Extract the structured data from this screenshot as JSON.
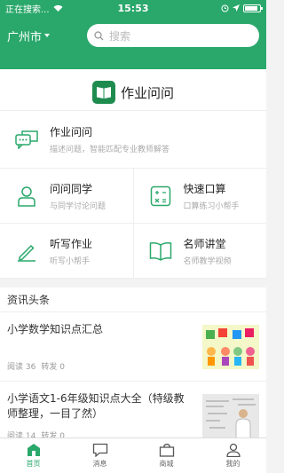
{
  "statusbar": {
    "carrier": "正在搜索...",
    "time": "15:53"
  },
  "nav": {
    "city": "广州市",
    "search_placeholder": "搜索"
  },
  "brand": {
    "title": "作业问问",
    "logo_text": "作业问问"
  },
  "features": {
    "main": {
      "title": "作业问问",
      "subtitle": "描述问题，智能匹配专业教师解答"
    },
    "items": [
      {
        "title": "问问同学",
        "subtitle": "与同学讨论问题"
      },
      {
        "title": "快速口算",
        "subtitle": "口算练习小帮手"
      },
      {
        "title": "听写作业",
        "subtitle": "听写小帮手"
      },
      {
        "title": "名师讲堂",
        "subtitle": "名师教学视频"
      }
    ]
  },
  "news": {
    "header": "资讯头条",
    "items": [
      {
        "title": "小学数学知识点汇总",
        "read_label": "阅读 36",
        "share_label": "转发 0"
      },
      {
        "title": "小学语文1-6年级知识点大全（特级教师整理，一目了然）",
        "read_label": "阅读 14",
        "share_label": "转发 0"
      }
    ]
  },
  "tabs": [
    {
      "label": "首页",
      "icon": "home-icon",
      "active": true
    },
    {
      "label": "消息",
      "icon": "message-icon",
      "active": false
    },
    {
      "label": "商城",
      "icon": "shop-bag-icon",
      "active": false
    },
    {
      "label": "我的",
      "icon": "profile-icon",
      "active": false
    }
  ],
  "colors": {
    "accent": "#2aa86b",
    "brand_dark": "#1f8c4f"
  }
}
